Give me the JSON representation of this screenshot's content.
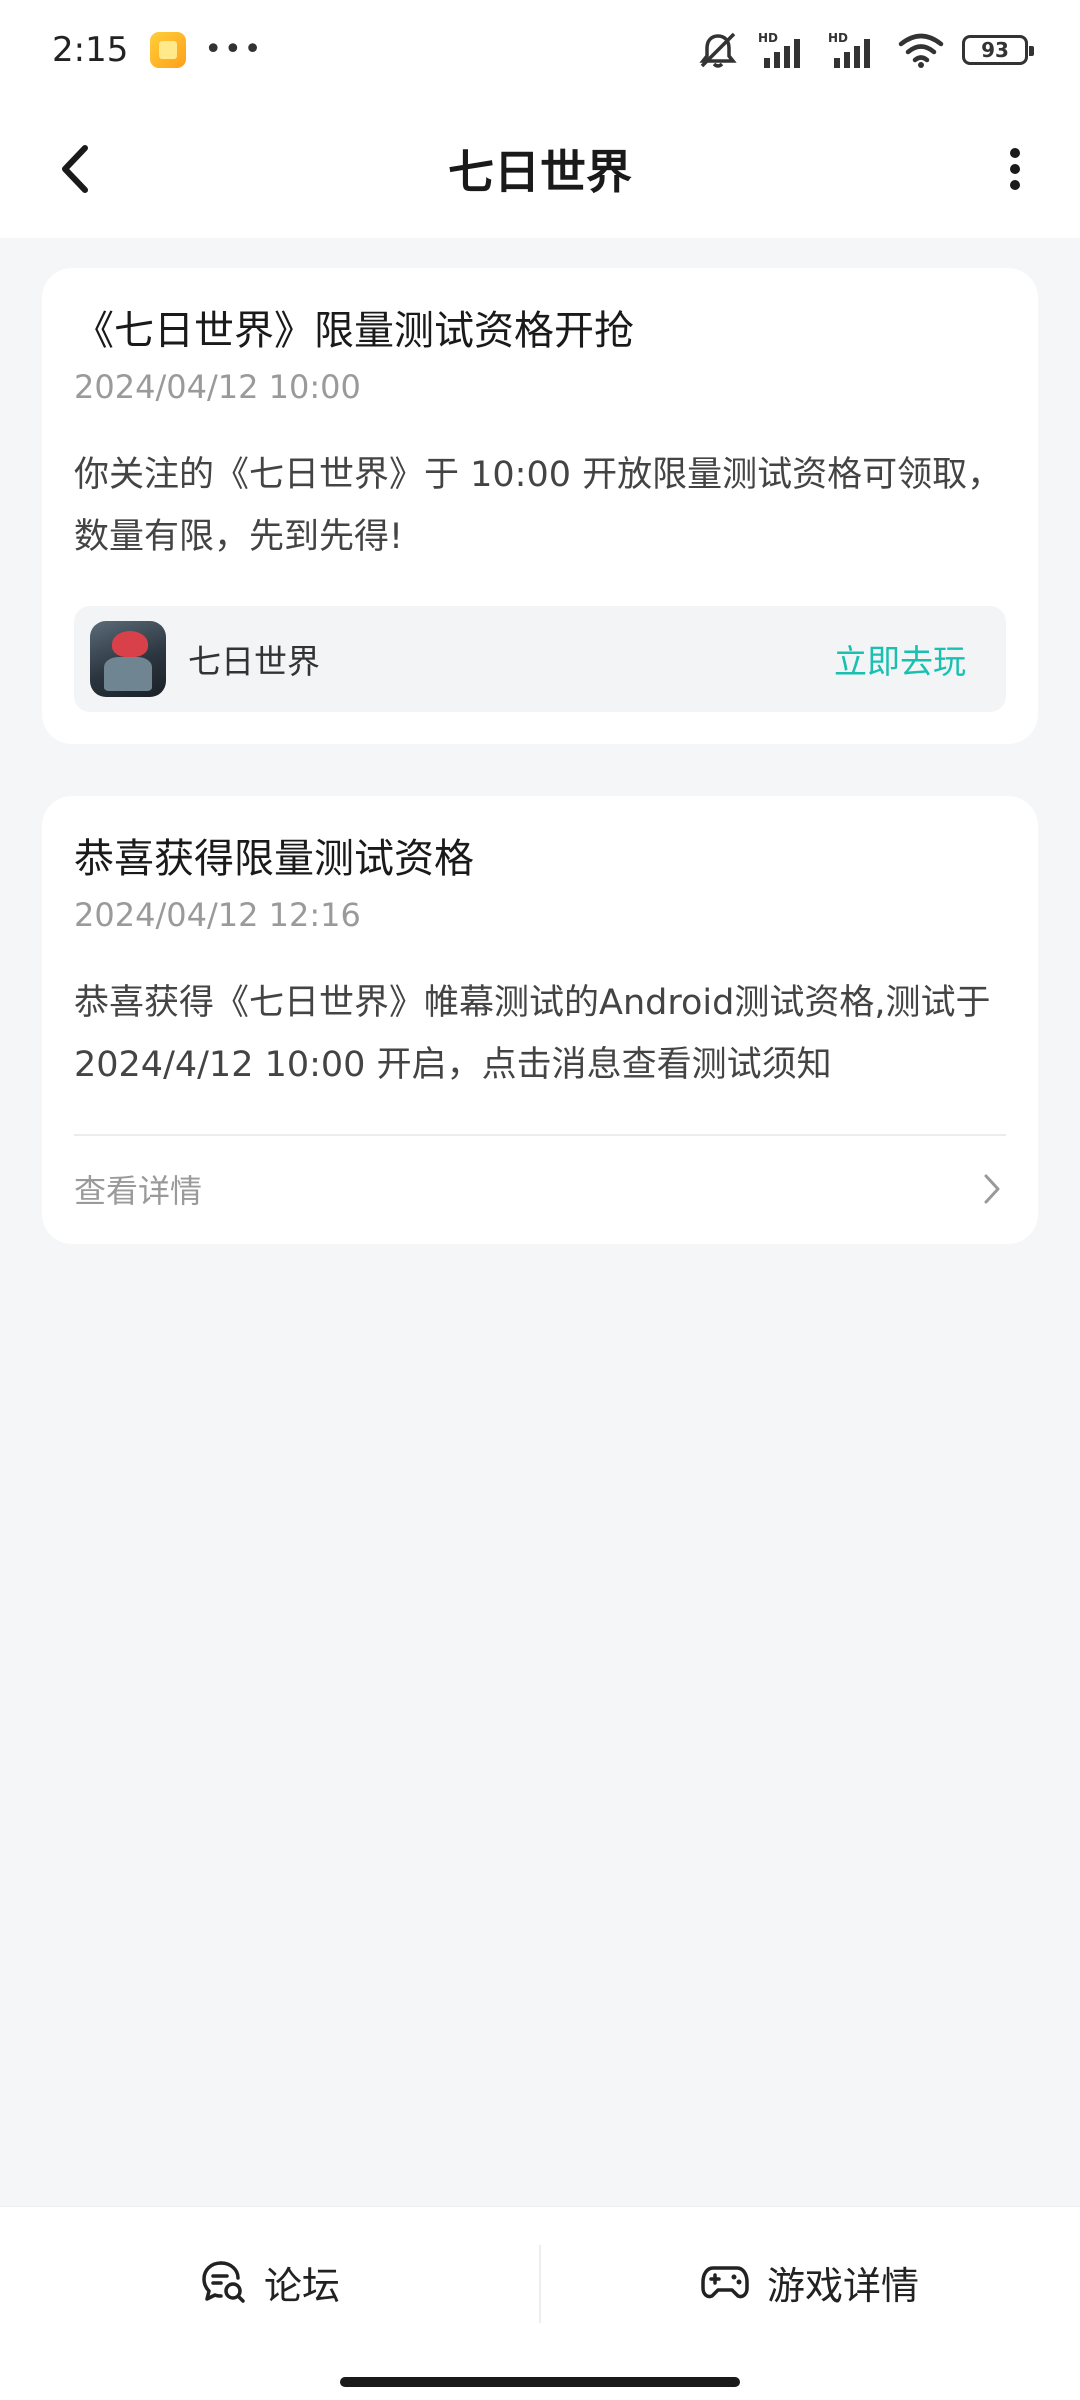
{
  "status_bar": {
    "time": "2:15",
    "battery": "93",
    "icons": [
      "app-notification-icon",
      "more-dots-icon",
      "mute-icon",
      "hd-signal-icon",
      "hd-signal-icon",
      "wifi-icon",
      "battery-icon"
    ]
  },
  "header": {
    "title": "七日世界"
  },
  "messages": [
    {
      "title": "《七日世界》限量测试资格开抢",
      "time": "2024/04/12 10:00",
      "body": "你关注的《七日世界》于 10:00 开放限量测试资格可领取，数量有限，先到先得!",
      "game_name": "七日世界",
      "action_label": "立即去玩"
    },
    {
      "title": "恭喜获得限量测试资格",
      "time": "2024/04/12 12:16",
      "body": "恭喜获得《七日世界》帷幕测试的Android测试资格,测试于 2024/4/12 10:00 开启，点击消息查看测试须知",
      "detail_label": "查看详情"
    }
  ],
  "bottom_bar": {
    "forum_label": "论坛",
    "game_detail_label": "游戏详情"
  },
  "colors": {
    "accent": "#19c0b0",
    "background": "#f5f6f8",
    "card": "#ffffff"
  }
}
